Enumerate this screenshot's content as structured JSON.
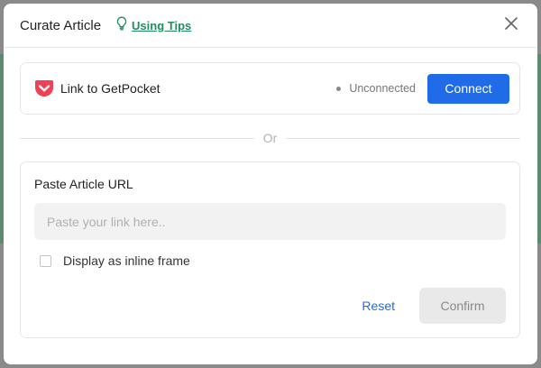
{
  "modal": {
    "title": "Curate Article",
    "tips_label": "Using Tips"
  },
  "pocket": {
    "label": "Link to GetPocket",
    "status": "Unconnected",
    "connect_label": "Connect"
  },
  "divider": {
    "label": "Or"
  },
  "url_section": {
    "heading": "Paste Article URL",
    "input_value": "",
    "input_placeholder": "Paste your link here..",
    "inline_frame_label": "Display as inline frame",
    "inline_frame_checked": false,
    "reset_label": "Reset",
    "confirm_label": "Confirm"
  },
  "colors": {
    "accent_blue": "#1f6be8",
    "tips_green": "#1f8f5f",
    "pocket_red": "#ef4056"
  },
  "icons": {
    "tips": "lightbulb-icon",
    "close": "close-icon",
    "pocket": "pocket-logo-icon"
  }
}
